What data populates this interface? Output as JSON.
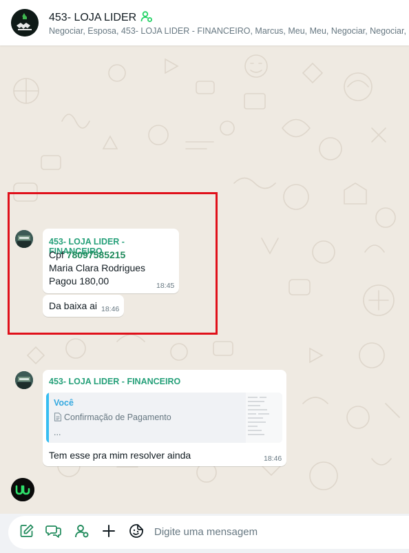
{
  "header": {
    "avatar_icon": "handshake-logo-icon",
    "title": "453- LOJA LIDER",
    "title_icon": "community-contact-icon",
    "members": "Negociar, Esposa, 453- LOJA LIDER - FINANCEIRO, Marcus, Meu, Meu, Negociar, Negociar, Ne"
  },
  "messages": [
    {
      "sender": "453- LOJA LIDER - FINANCEIRO",
      "cpf_label": "Cpf",
      "cpf_value": "78097585215",
      "line2": "Maria Clara Rodrigues",
      "line3": "Pagou 180,00",
      "time": "18:45"
    },
    {
      "text": "Da baixa ai",
      "time": "18:46"
    },
    {
      "sender": "453- LOJA LIDER - FINANCEIRO",
      "quote_author": "Você",
      "quote_text": "Confirmação de Pagamento",
      "quote_more": "...",
      "text": "Tem esse pra mim resolver ainda",
      "time": "18:46"
    }
  ],
  "composer": {
    "placeholder": "Digite uma mensagem",
    "tools": [
      "pencil-square-icon",
      "chat-bubbles-icon",
      "contact-icon",
      "plus-icon",
      "sticker-icon"
    ]
  },
  "colors": {
    "highlight": "#e0101a",
    "sender_name": "#25a079",
    "accent_green": "#1f8a5b",
    "quote_bar": "#35bdf1",
    "chat_bg": "#efeae2"
  }
}
